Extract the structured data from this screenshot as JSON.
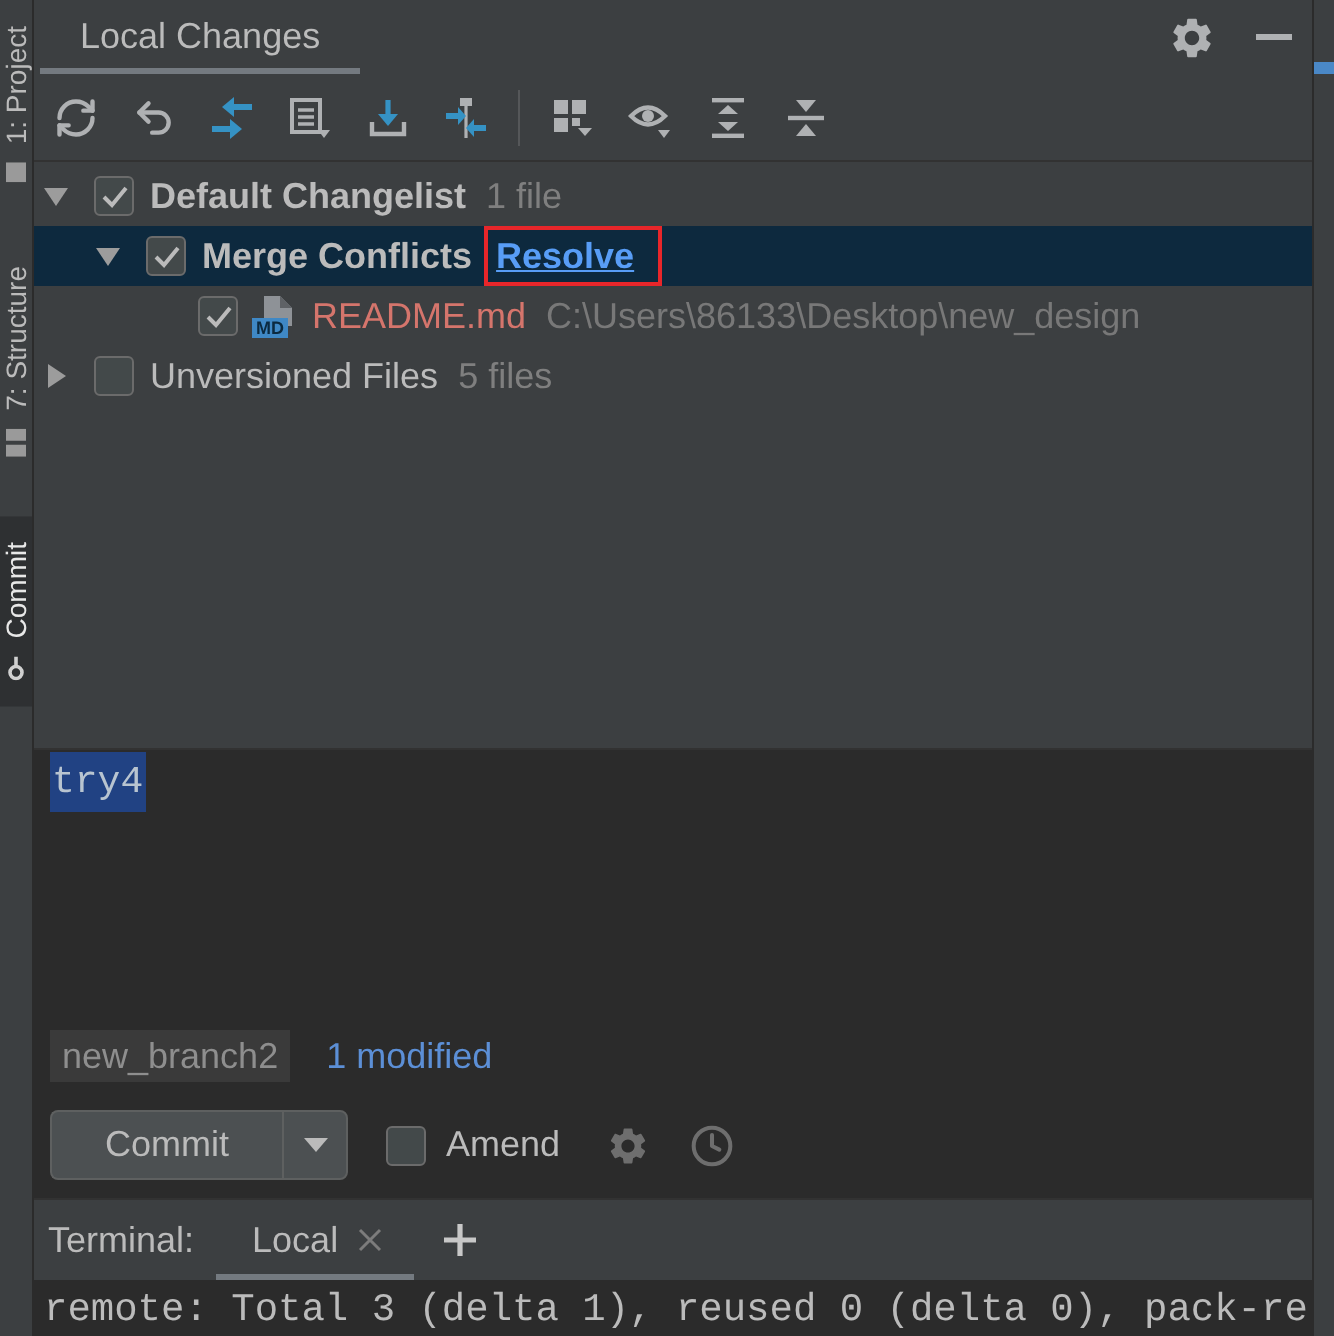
{
  "tool_strip": {
    "tabs": [
      {
        "label": "1: Project",
        "selected": false
      },
      {
        "label": "7: Structure",
        "selected": false
      },
      {
        "label": "Commit",
        "selected": true
      }
    ]
  },
  "panel": {
    "tabs": [
      {
        "label": "Local Changes",
        "selected": true
      }
    ]
  },
  "tree": [
    {
      "kind": "changelist",
      "label": "Default Changelist",
      "detail": "1 file",
      "checked": true,
      "expanded": true,
      "selected": false,
      "children": [
        {
          "kind": "conflicts",
          "label": "Merge Conflicts",
          "link": {
            "label": "Resolve",
            "boxed": true
          },
          "checked": true,
          "expanded": true,
          "selected": true,
          "children": [
            {
              "kind": "file",
              "label": "README.md",
              "file_type": "MD",
              "color": "#d5756c",
              "path": "C:\\Users\\86133\\Desktop\\new_design",
              "checked": true,
              "selected": false
            }
          ]
        }
      ]
    },
    {
      "kind": "unversioned",
      "label": "Unversioned Files",
      "detail": "5 files",
      "checked": false,
      "expanded": false,
      "selected": false
    }
  ],
  "message": {
    "value": "try4",
    "selected": true
  },
  "status": {
    "branch": "new_branch2",
    "changes": "1 modified"
  },
  "actions": {
    "commit": "Commit",
    "amend": {
      "label": "Amend",
      "checked": false
    }
  },
  "terminal": {
    "label": "Terminal:",
    "tabs": [
      {
        "label": "Local",
        "selected": true
      }
    ],
    "output": [
      "remote: Total 3 (delta 1), reused 0 (delta 0), pack-re"
    ]
  }
}
